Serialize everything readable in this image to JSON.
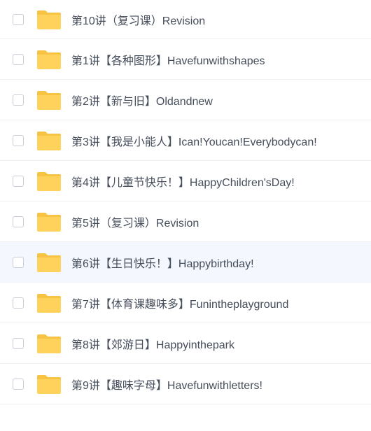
{
  "file_list": {
    "items": [
      {
        "name": "第10讲（复习课）Revision",
        "icon": "folder-icon",
        "checked": false
      },
      {
        "name": "第1讲【各种图形】Havefunwithshapes",
        "icon": "folder-icon",
        "checked": false
      },
      {
        "name": "第2讲【新与旧】Oldandnew",
        "icon": "folder-icon",
        "checked": false
      },
      {
        "name": "第3讲【我是小能人】Ican!Youcan!Everybodycan!",
        "icon": "folder-icon",
        "checked": false
      },
      {
        "name": "第4讲【儿童节快乐！】HappyChildren'sDay!",
        "icon": "folder-icon",
        "checked": false
      },
      {
        "name": "第5讲（复习课）Revision",
        "icon": "folder-icon",
        "checked": false
      },
      {
        "name": "第6讲【生日快乐！】Happybirthday!",
        "icon": "folder-icon",
        "checked": false,
        "hovered": true
      },
      {
        "name": "第7讲【体育课趣味多】Funintheplayground",
        "icon": "folder-icon",
        "checked": false
      },
      {
        "name": "第8讲【郊游日】Happyinthepark",
        "icon": "folder-icon",
        "checked": false
      },
      {
        "name": "第9讲【趣味字母】Havefunwithletters!",
        "icon": "folder-icon",
        "checked": false
      }
    ]
  },
  "colors": {
    "folder": "#ffd35b",
    "folder_tab": "#f6c342",
    "text": "#454d5a",
    "hover_row": "#f4f8fe",
    "checkbox_border": "#c9ced6",
    "divider": "#f0f1f3"
  }
}
